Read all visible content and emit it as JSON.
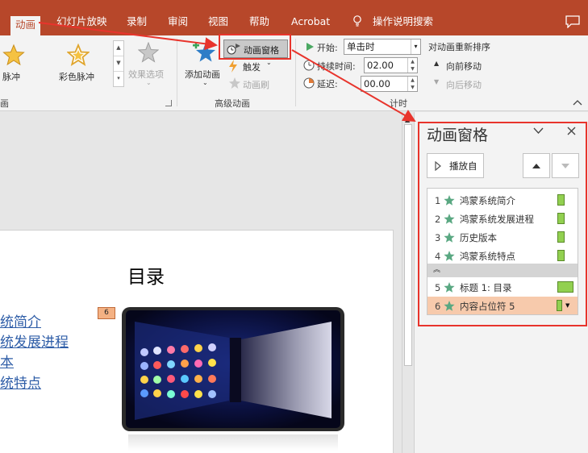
{
  "tabs": [
    {
      "label": "动画",
      "active": true
    },
    {
      "label": "幻灯片放映"
    },
    {
      "label": "录制"
    },
    {
      "label": "审阅"
    },
    {
      "label": "视图"
    },
    {
      "label": "帮助"
    },
    {
      "label": "Acrobat"
    },
    {
      "label": "操作说明搜索"
    }
  ],
  "ribbon": {
    "effects": {
      "pulse": "脉冲",
      "color_pulse": "彩色脉冲",
      "effect_options": "效果选项",
      "group_label": "画"
    },
    "advanced": {
      "add_animation": "添加动画",
      "animation_pane": "动画窗格",
      "trigger": "触发",
      "animation_painter": "动画刷",
      "group_label": "高级动画"
    },
    "timing": {
      "start_label": "开始:",
      "start_value": "单击时",
      "duration_label": "持续时间:",
      "duration_value": "02.00",
      "delay_label": "延迟:",
      "delay_value": "00.00",
      "group_label": "计时"
    },
    "reorder": {
      "title": "对动画重新排序",
      "move_earlier": "向前移动",
      "move_later": "向后移动"
    }
  },
  "slide": {
    "title": "目录",
    "toc_items": [
      "统简介",
      "统发展进程",
      "本",
      "统特点"
    ],
    "anim_tag": "6"
  },
  "pane": {
    "title": "动画窗格",
    "play_button": "播放自",
    "items": [
      {
        "num": "1",
        "text": "鸿蒙系统简介"
      },
      {
        "num": "2",
        "text": "鸿蒙系统发展进程"
      },
      {
        "num": "3",
        "text": "历史版本"
      },
      {
        "num": "4",
        "text": "鸿蒙系统特点"
      },
      {
        "num": "5",
        "text": "标题 1: 目录"
      },
      {
        "num": "6",
        "text": "内容占位符 5",
        "selected": true
      }
    ]
  },
  "colors": {
    "accent": "#b7472a",
    "annotation": "#e8342c",
    "star": "#5aa882",
    "bar": "#92d050",
    "selected": "#f7caac"
  }
}
